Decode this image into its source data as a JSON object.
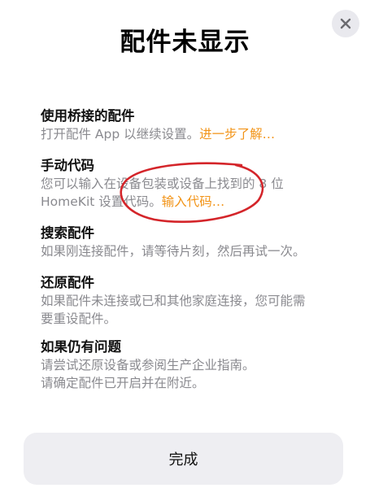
{
  "title": "配件未显示",
  "close_icon": "xmark-icon",
  "sections": [
    {
      "title": "使用桥接的配件",
      "lines": [
        "打开配件 App 以继续设置。"
      ],
      "link": "进一步了解…"
    },
    {
      "title": "手动代码",
      "lines": [
        "您可以输入在设备包装或设备上找到的 8 位",
        "HomeKit 设置代码。"
      ],
      "link": "输入代码…"
    },
    {
      "title": "搜索配件",
      "lines": [
        "如果刚连接配件，请等待片刻，然后再试一次。"
      ]
    },
    {
      "title": "还原配件",
      "lines": [
        "如果配件未连接或已和其他家庭连接，您可能需",
        "要重设配件。"
      ]
    },
    {
      "title": "如果仍有问题",
      "lines": [
        "请尝试还原设备或参阅生产企业指南。",
        "请确定配件已开启并在附近。"
      ]
    }
  ],
  "done_label": "完成",
  "colors": {
    "link": "#f29418",
    "annotation": "#d4252a",
    "button_bg": "#eeeef2"
  }
}
